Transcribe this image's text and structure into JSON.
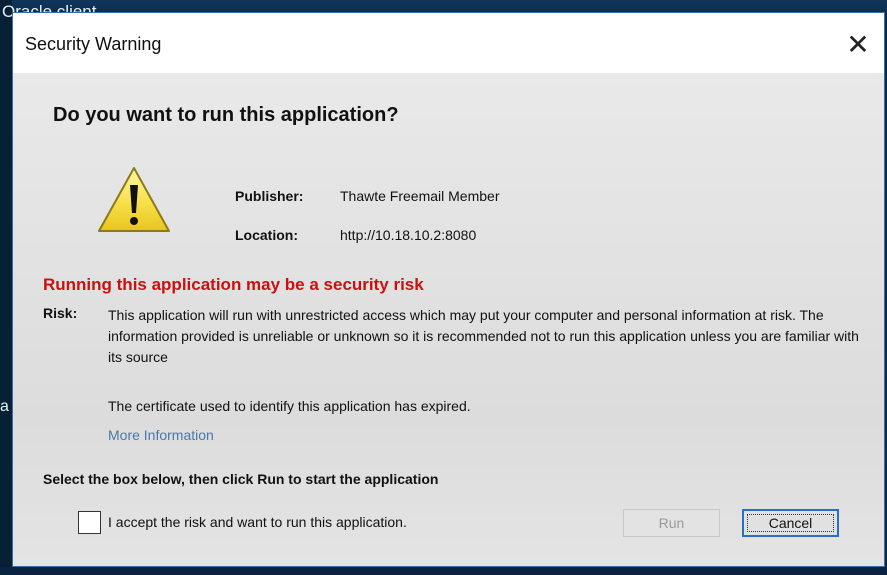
{
  "background": {
    "window_title": "Oracle client",
    "side_letter": "a"
  },
  "dialog": {
    "title": "Security Warning",
    "close_glyph": "✕",
    "question": "Do you want to run this application?",
    "icon": "warning-icon",
    "publisher_label": "Publisher:",
    "publisher_value": "Thawte Freemail Member",
    "location_label": "Location:",
    "location_value": "http://10.18.10.2:8080",
    "risk_heading": "Running this application may be a security risk",
    "risk_label": "Risk:",
    "risk_text": "This application will run with unrestricted access which may put your computer and personal information at risk. The information provided is unreliable or unknown so it is recommended not to run this application unless you are familiar with its source",
    "expired_text": "The certificate used to identify this application has expired.",
    "more_info": "More Information",
    "instruction": "Select the box below, then click Run to start the application",
    "accept_label": "I accept the risk and want to run this application.",
    "accept_checked": false,
    "run_label": "Run",
    "cancel_label": "Cancel"
  },
  "colors": {
    "risk_heading": "#cc1010",
    "link": "#4a78a8",
    "focus_border": "#2b6fc2"
  }
}
